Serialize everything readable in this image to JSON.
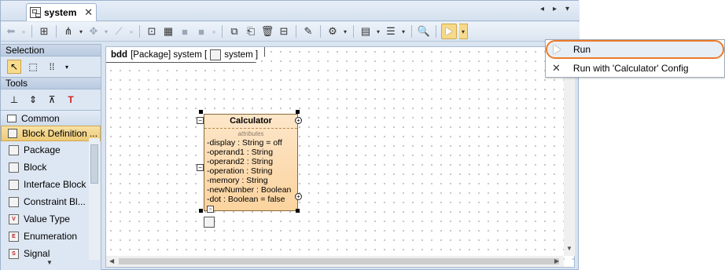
{
  "window": {
    "tab_label": "system",
    "tab_close": "✕",
    "nav_prev": "◂",
    "nav_next": "▸",
    "nav_menu": "▾"
  },
  "toolbar": {
    "icons": [
      "back-icon",
      "hierarchy-icon",
      "tree-layout-icon",
      "relationship-icon",
      "line-icon",
      "insert-shape-icon",
      "table-icon",
      "box-icon",
      "box2-icon",
      "copy-icon",
      "paste-icon",
      "delete-icon",
      "split-icon",
      "format-icon",
      "gear-icon",
      "diagram-icon",
      "list-icon",
      "zoom-icon",
      "run-icon"
    ]
  },
  "palette": {
    "selection_label": "Selection",
    "tools_label": "Tools",
    "groups": [
      {
        "label": "Common"
      },
      {
        "label": "Block Definition ..."
      }
    ],
    "items": [
      {
        "label": "Package",
        "icon": "package-icon"
      },
      {
        "label": "Block",
        "icon": "block-icon"
      },
      {
        "label": "Interface Block",
        "icon": "interface-block-icon"
      },
      {
        "label": "Constraint Bl...",
        "icon": "constraint-block-icon"
      },
      {
        "label": "Value Type",
        "icon": "value-type-icon",
        "glyph": "V"
      },
      {
        "label": "Enumeration",
        "icon": "enumeration-icon",
        "glyph": "E"
      },
      {
        "label": "Signal",
        "icon": "signal-icon",
        "glyph": "S"
      }
    ]
  },
  "diagram": {
    "kind": "bdd",
    "header_text": "[Package] system [",
    "header_name": "system ]"
  },
  "block": {
    "name": "Calculator",
    "section": "attributes",
    "attributes": [
      "-display : String = off",
      "-operand1 : String",
      "-operand2 : String",
      "-operation : String",
      "-memory : String",
      "-newNumber : Boolean",
      "-dot : Boolean = false"
    ]
  },
  "menu": {
    "items": [
      {
        "label": "Run",
        "icon": "run-icon",
        "highlighted": true
      },
      {
        "label": "Run with 'Calculator' Config",
        "icon": "tools-icon",
        "highlighted": false
      }
    ],
    "highlight_color": "#ec7a2a"
  }
}
